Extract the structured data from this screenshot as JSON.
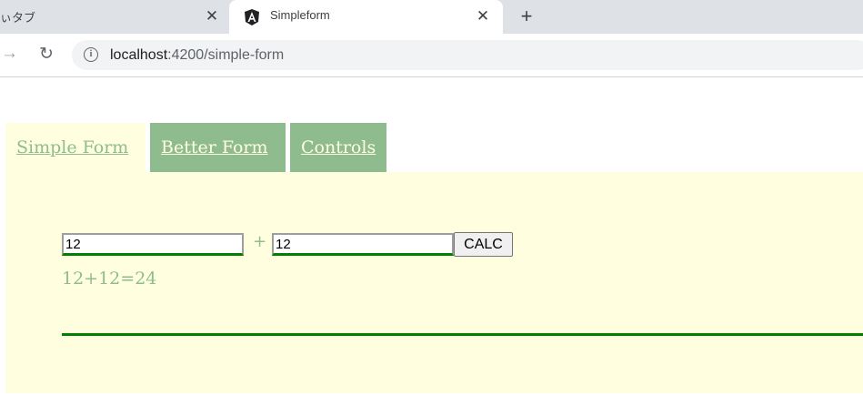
{
  "browser": {
    "tabs": [
      {
        "title": "ぃタブ",
        "close": "✕"
      },
      {
        "title": "Simpleform",
        "close": "✕"
      }
    ],
    "new_tab": "+",
    "forward_icon": "→",
    "reload_icon": "↻",
    "info_icon": "i",
    "url_host": "localhost",
    "url_path": ":4200/simple-form"
  },
  "app": {
    "tabs": [
      {
        "label": "Simple Form "
      },
      {
        "label": "Better Form "
      },
      {
        "label": "Controls"
      }
    ],
    "form": {
      "input_a": "12",
      "operator": "+",
      "input_b": "12",
      "calc_label": "CALC",
      "result": "12+12=24"
    }
  },
  "colors": {
    "tab_inactive_bg": "#8fbc8f",
    "panel_bg": "#ffffe0",
    "accent_green": "#008000",
    "angular_red": "#202124"
  }
}
